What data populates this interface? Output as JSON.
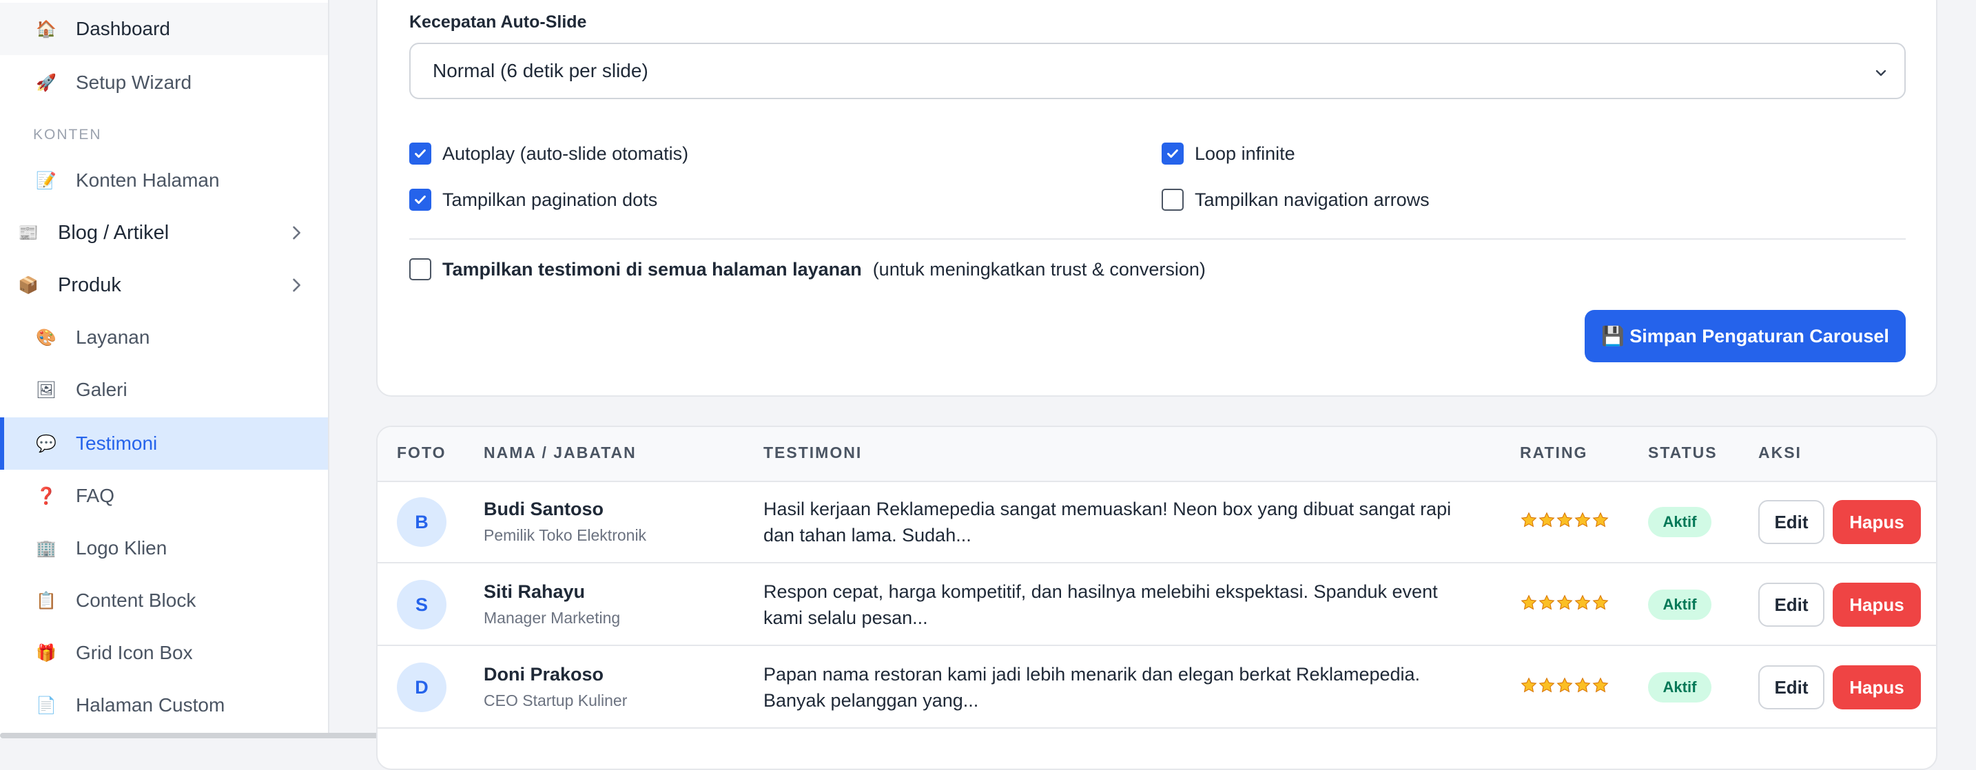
{
  "sidebar": {
    "items": [
      {
        "label": "Dashboard",
        "icon": "house-icon",
        "glyph": "🏠"
      },
      {
        "label": "Setup Wizard",
        "icon": "rocket-icon",
        "glyph": "🚀"
      },
      {
        "label": "Konten Halaman",
        "icon": "memo-icon",
        "glyph": "📝"
      },
      {
        "label": "Blog / Artikel",
        "icon": "newspaper-icon",
        "glyph": "📰"
      },
      {
        "label": "Produk",
        "icon": "package-icon",
        "glyph": "📦"
      },
      {
        "label": "Layanan",
        "icon": "palette-icon",
        "glyph": "🎨"
      },
      {
        "label": "Galeri",
        "icon": "picture-icon",
        "glyph": "🖼"
      },
      {
        "label": "Testimoni",
        "icon": "speech-bubble-icon",
        "glyph": "💬"
      },
      {
        "label": "FAQ",
        "icon": "question-mark-icon",
        "glyph": "❓"
      },
      {
        "label": "Logo Klien",
        "icon": "office-building-icon",
        "glyph": "🏢"
      },
      {
        "label": "Content Block",
        "icon": "clipboard-icon",
        "glyph": "📋"
      },
      {
        "label": "Grid Icon Box",
        "icon": "gift-icon",
        "glyph": "🎁"
      },
      {
        "label": "Halaman Custom",
        "icon": "page-icon",
        "glyph": "📄"
      }
    ],
    "section_konten": "KONTEN"
  },
  "settings": {
    "speed_label": "Kecepatan Auto-Slide",
    "speed_value": "Normal (6 detik per slide)",
    "autoplay_label": "Autoplay (auto-slide otomatis)",
    "loop_label": "Loop infinite",
    "dots_label": "Tampilkan pagination dots",
    "arrows_label": "Tampilkan navigation arrows",
    "testimoni_all_bold": "Tampilkan testimoni di semua halaman layanan",
    "testimoni_all_note": "(untuk meningkatkan trust & conversion)",
    "save_label": "💾 Simpan Pengaturan Carousel"
  },
  "table": {
    "headers": {
      "foto": "FOTO",
      "nama": "NAMA / JABATAN",
      "testimoni": "TESTIMONI",
      "rating": "RATING",
      "status": "STATUS",
      "aksi": "AKSI"
    },
    "rows": [
      {
        "initial": "B",
        "name": "Budi Santoso",
        "role": "Pemilik Toko Elektronik",
        "text": "Hasil kerjaan Reklamepedia sangat memuaskan! Neon box yang dibuat sangat rapi dan tahan lama. Sudah...",
        "rating": 5,
        "status": "Aktif",
        "edit": "Edit",
        "delete": "Hapus"
      },
      {
        "initial": "S",
        "name": "Siti Rahayu",
        "role": "Manager Marketing",
        "text": "Respon cepat, harga kompetitif, dan hasilnya melebihi ekspektasi. Spanduk event kami selalu pesan...",
        "rating": 5,
        "status": "Aktif",
        "edit": "Edit",
        "delete": "Hapus"
      },
      {
        "initial": "D",
        "name": "Doni Prakoso",
        "role": "CEO Startup Kuliner",
        "text": "Papan nama restoran kami jadi lebih menarik dan elegan berkat Reklamepedia. Banyak pelanggan yang...",
        "rating": 5,
        "status": "Aktif",
        "edit": "Edit",
        "delete": "Hapus"
      }
    ]
  },
  "colors": {
    "accent": "#2563eb",
    "danger": "#ef4444",
    "success_bg": "#d1fae5",
    "success_text": "#047857",
    "star": "#fbbf24"
  }
}
